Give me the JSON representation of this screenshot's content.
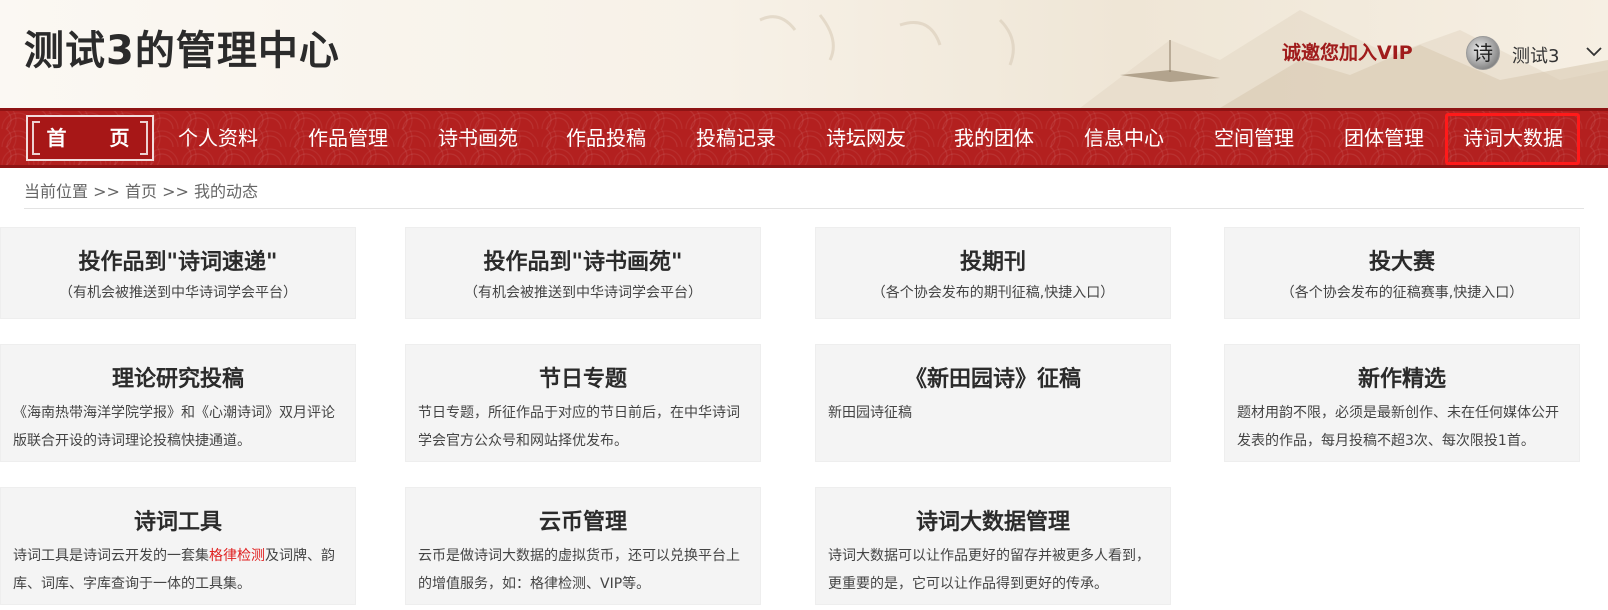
{
  "header": {
    "site_title": "测试3的管理中心",
    "vip_link": "诚邀您加入VIP",
    "avatar_glyph": "诗",
    "username": "测试3"
  },
  "nav": {
    "home": "首 页",
    "items": [
      "个人资料",
      "作品管理",
      "诗书画苑",
      "作品投稿",
      "投稿记录",
      "诗坛网友",
      "我的团体",
      "信息中心",
      "空间管理",
      "团体管理",
      "诗词大数据"
    ],
    "highlighted": "诗词大数据",
    "highlight_color": "#ff1a1a",
    "bar_color": "#b3201f"
  },
  "breadcrumb": "当前位置 >> 首页 >> 我的动态",
  "cards": [
    {
      "title": "投作品到\"诗词速递\"",
      "subtitle": "（有机会被推送到中华诗词学会平台）"
    },
    {
      "title": "投作品到\"诗书画苑\"",
      "subtitle": "（有机会被推送到中华诗词学会平台）"
    },
    {
      "title": "投期刊",
      "subtitle": "（各个协会发布的期刊征稿,快捷入口）"
    },
    {
      "title": "投大赛",
      "subtitle": "（各个协会发布的征稿赛事,快捷入口）"
    },
    {
      "title": "理论研究投稿",
      "description": "《海南热带海洋学院学报》和《心潮诗词》双月评论版联合开设的诗词理论投稿快捷通道。"
    },
    {
      "title": "节日专题",
      "description": "节日专题，所征作品于对应的节日前后，在中华诗词学会官方公众号和网站择优发布。"
    },
    {
      "title": "《新田园诗》征稿",
      "description": "新田园诗征稿"
    },
    {
      "title": "新作精选",
      "description": "题材用韵不限，必须是最新创作、未在任何媒体公开发表的作品，每月投稿不超3次、每次限投1首。"
    },
    {
      "title": "诗词工具",
      "description_before": "诗词工具是诗词云开发的一套集",
      "description_highlight": "格律检测",
      "description_after": "及词牌、韵库、词库、字库查询于一体的工具集。"
    },
    {
      "title": "云币管理",
      "description": "云币是做诗词大数据的虚拟货币，还可以兑换平台上的增值服务，如：格律检测、VIP等。"
    },
    {
      "title": "诗词大数据管理",
      "description": "诗词大数据可以让作品更好的留存并被更多人看到，更重要的是，它可以让作品得到更好的传承。"
    }
  ],
  "icons": {
    "user_menu": "chevron-down-icon"
  },
  "colors": {
    "vip": "#a01c1c",
    "highlight_text": "#e02020"
  }
}
